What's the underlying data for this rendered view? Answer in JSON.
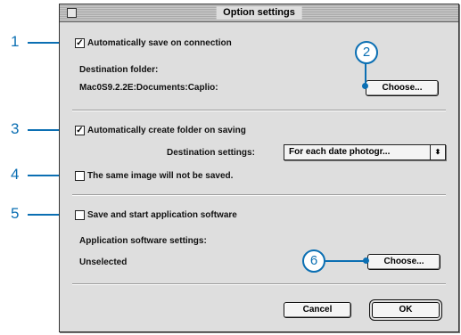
{
  "window": {
    "title": "Option settings"
  },
  "auto_save": {
    "label": "Automatically save on connection",
    "checked": true,
    "check_mark": "✓"
  },
  "destination": {
    "label": "Destination folder:",
    "path": "Mac0S9.2.2E:Documents:Caplio:",
    "choose_label": "Choose..."
  },
  "auto_folder": {
    "label": "Automatically create folder on saving",
    "checked": true,
    "check_mark": "✓"
  },
  "destination_settings": {
    "label": "Destination settings:",
    "value": "For each date photogr...",
    "arrow": "⬍"
  },
  "same_image": {
    "label": "The same image will not be saved.",
    "checked": false,
    "check_mark": ""
  },
  "start_app": {
    "label": "Save and start application software",
    "checked": false,
    "check_mark": ""
  },
  "app_settings": {
    "label": "Application software settings:",
    "value": "Unselected",
    "choose_label": "Choose..."
  },
  "buttons": {
    "cancel": "Cancel",
    "ok": "OK"
  },
  "callouts": {
    "c1": "1",
    "c2": "2",
    "c3": "3",
    "c4": "4",
    "c5": "5",
    "c6": "6"
  },
  "colors": {
    "callout": "#0b6fb3",
    "dialog_bg": "#dedede"
  }
}
